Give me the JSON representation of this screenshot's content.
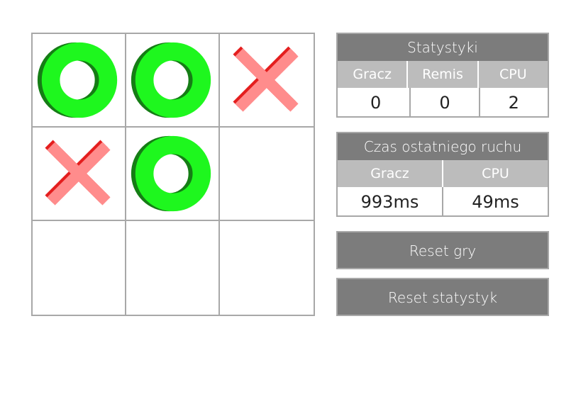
{
  "board": {
    "cells": [
      "O",
      "O",
      "X",
      "X",
      "O",
      "",
      "",
      "",
      ""
    ]
  },
  "stats": {
    "title": "Statystyki",
    "headers": [
      "Gracz",
      "Remis",
      "CPU"
    ],
    "values": [
      "0",
      "0",
      "2"
    ]
  },
  "last_move": {
    "title": "Czas ostatniego ruchu",
    "headers": [
      "Gracz",
      "CPU"
    ],
    "values": [
      "993ms",
      "49ms"
    ]
  },
  "buttons": {
    "reset_game": "Reset gry",
    "reset_stats": "Reset statystyk"
  },
  "colors": {
    "o_mark": "#1ef71e",
    "o_shadow": "#157d15",
    "x_mark": "#ff8c8c",
    "x_shadow": "#e41e1e",
    "header_dark": "#7c7c7c",
    "header_light": "#bcbcbc",
    "grid_line": "#a8a8a8"
  },
  "icons": {
    "o": "circle-o-icon",
    "x": "cross-x-icon"
  }
}
